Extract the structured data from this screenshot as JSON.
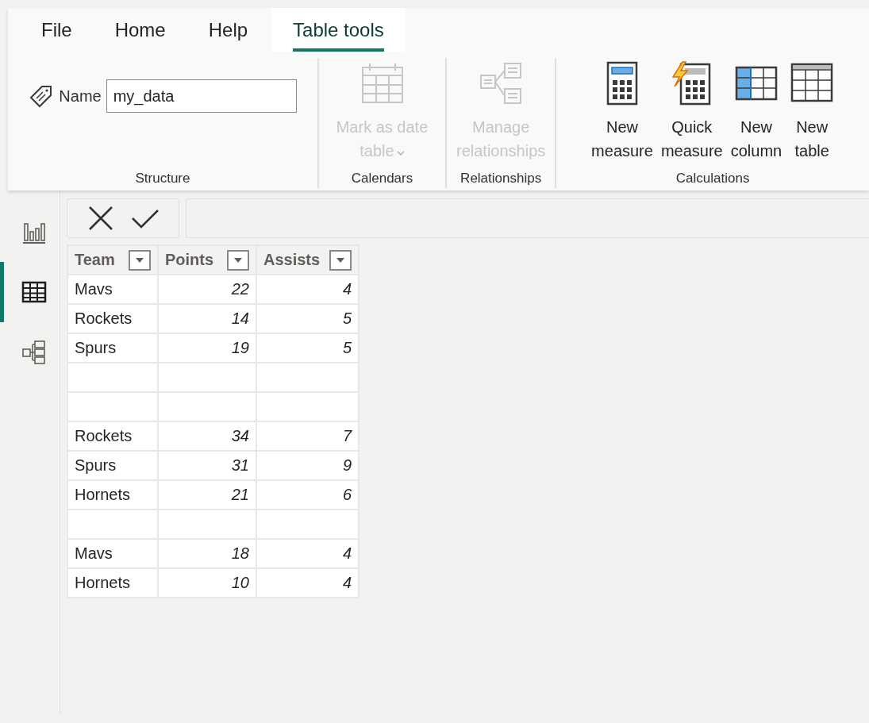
{
  "tabs": [
    {
      "label": "File",
      "selected": false
    },
    {
      "label": "Home",
      "selected": false
    },
    {
      "label": "Help",
      "selected": false
    },
    {
      "label": "Table tools",
      "selected": true
    }
  ],
  "ribbon": {
    "groups": [
      {
        "label": "Structure",
        "kind": "name",
        "field_label": "Name",
        "value": "my_data"
      },
      {
        "label": "Calendars",
        "kind": "buttons",
        "buttons": [
          {
            "label": "Mark as date table",
            "disabled": true,
            "dropdown": true
          }
        ]
      },
      {
        "label": "Relationships",
        "kind": "buttons",
        "buttons": [
          {
            "label": "Manage relationships",
            "disabled": true,
            "dropdown": false
          }
        ]
      },
      {
        "label": "Calculations",
        "kind": "buttons",
        "buttons": [
          {
            "label": "New measure",
            "disabled": false,
            "dropdown": false
          },
          {
            "label": "Quick measure",
            "disabled": false,
            "dropdown": false
          },
          {
            "label": "New column",
            "disabled": false,
            "dropdown": false
          },
          {
            "label": "New table",
            "disabled": false,
            "dropdown": false
          }
        ]
      }
    ]
  },
  "sidebar": {
    "items": [
      {
        "selected": false
      },
      {
        "selected": true
      },
      {
        "selected": false
      }
    ]
  },
  "table": {
    "columns": [
      {
        "label": "Team",
        "kind": "text"
      },
      {
        "label": "Points",
        "kind": "number"
      },
      {
        "label": "Assists",
        "kind": "number"
      }
    ],
    "rows": [
      {
        "kind": "data",
        "cells": [
          "Mavs",
          "22",
          "4"
        ]
      },
      {
        "kind": "data",
        "cells": [
          "Rockets",
          "14",
          "5"
        ]
      },
      {
        "kind": "data",
        "cells": [
          "Spurs",
          "19",
          "5"
        ]
      },
      {
        "kind": "blank"
      },
      {
        "kind": "blank"
      },
      {
        "kind": "data",
        "cells": [
          "Rockets",
          "34",
          "7"
        ]
      },
      {
        "kind": "data",
        "cells": [
          "Spurs",
          "31",
          "9"
        ]
      },
      {
        "kind": "data",
        "cells": [
          "Hornets",
          "21",
          "6"
        ]
      },
      {
        "kind": "blank"
      },
      {
        "kind": "data",
        "cells": [
          "Mavs",
          "18",
          "4"
        ]
      },
      {
        "kind": "data",
        "cells": [
          "Hornets",
          "10",
          "4"
        ]
      }
    ]
  }
}
